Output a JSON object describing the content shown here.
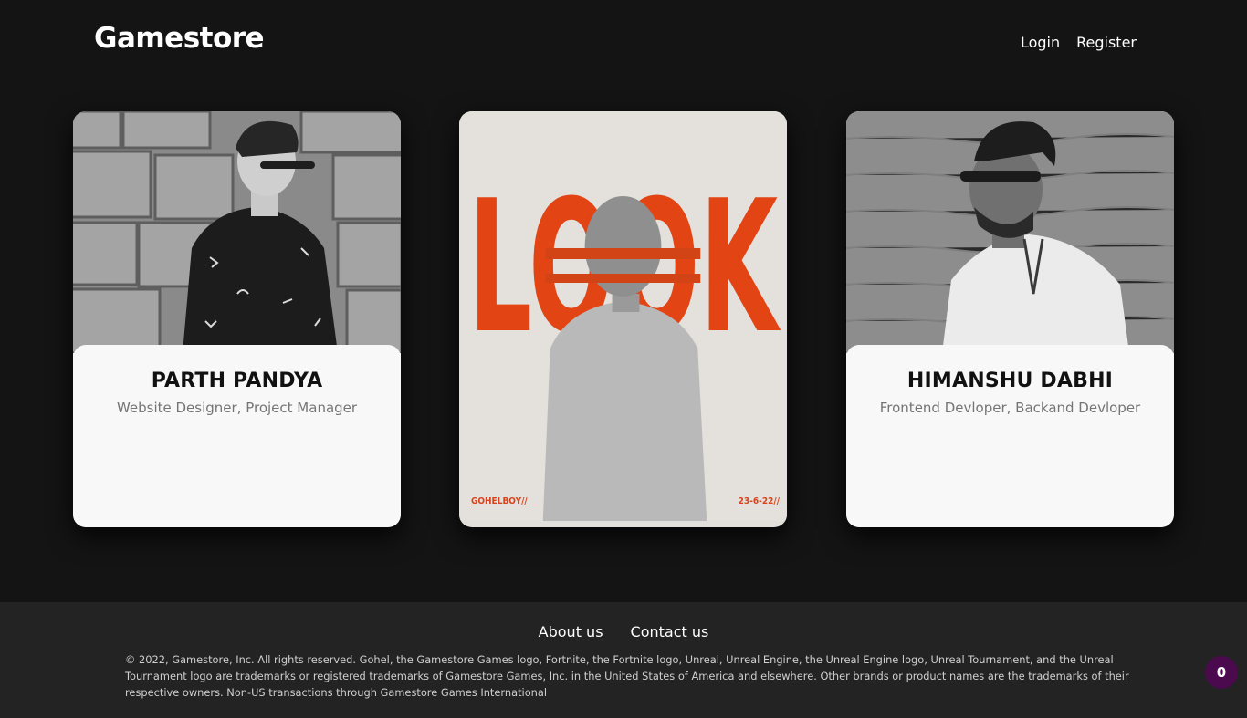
{
  "header": {
    "logo": "Gamestore",
    "nav": {
      "login": "Login",
      "register": "Register"
    }
  },
  "team": [
    {
      "name": "PARTH PANDYA",
      "role": "Website Designer, Project Manager"
    },
    {
      "poster_word": "LOOK",
      "poster_left_tag": "GOHELBOY//",
      "poster_right_tag": "23-6-22//"
    },
    {
      "name": "HIMANSHU DABHI",
      "role": "Frontend Devloper, Backand Devloper"
    }
  ],
  "footer": {
    "links": {
      "about": "About us",
      "contact": "Contact us"
    },
    "copyright": "© 2022, Gamestore, Inc. All rights reserved. Gohel, the Gamestore Games logo, Fortnite, the Fortnite logo, Unreal, Unreal Engine, the Unreal Engine logo, Unreal Tournament, and the Unreal Tournament logo are trademarks or registered trademarks of Gamestore Games, Inc. in the United States of America and elsewhere. Other brands or product names are the trademarks of their respective owners. Non-US transactions through Gamestore Games International"
  },
  "cart": {
    "count": "0"
  },
  "colors": {
    "accent": "#d8431b",
    "badge": "#4b0a4e",
    "background": "#141414",
    "footer": "#232323"
  }
}
